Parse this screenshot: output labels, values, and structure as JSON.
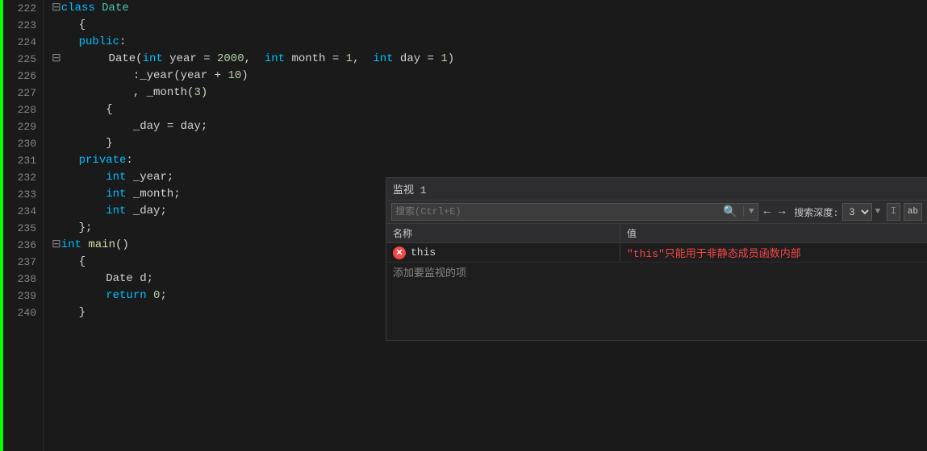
{
  "editor": {
    "lines": [
      {
        "num": "222",
        "content": [
          {
            "t": "⊟",
            "cls": "collapse"
          },
          {
            "t": "class ",
            "cls": "cyan"
          },
          {
            "t": "Date",
            "cls": "green"
          }
        ]
      },
      {
        "num": "223",
        "content": [
          {
            "t": "    {",
            "cls": "normal"
          }
        ]
      },
      {
        "num": "224",
        "content": [
          {
            "t": "    ",
            "cls": "normal"
          },
          {
            "t": "public",
            "cls": "cyan"
          },
          {
            "t": ":",
            "cls": "normal"
          }
        ]
      },
      {
        "num": "225",
        "content": [
          {
            "t": "⊟   ",
            "cls": "collapse"
          },
          {
            "t": "    Date(",
            "cls": "normal"
          },
          {
            "t": "int",
            "cls": "cyan"
          },
          {
            "t": " year = ",
            "cls": "normal"
          },
          {
            "t": "2000",
            "cls": "num"
          },
          {
            "t": ",  ",
            "cls": "normal"
          },
          {
            "t": "int",
            "cls": "cyan"
          },
          {
            "t": " month = ",
            "cls": "normal"
          },
          {
            "t": "1",
            "cls": "num"
          },
          {
            "t": ",  ",
            "cls": "normal"
          },
          {
            "t": "int",
            "cls": "cyan"
          },
          {
            "t": " day = ",
            "cls": "normal"
          },
          {
            "t": "1",
            "cls": "num"
          },
          {
            "t": ")",
            "cls": "normal"
          }
        ]
      },
      {
        "num": "226",
        "content": [
          {
            "t": "    ",
            "cls": "normal"
          },
          {
            "t": "    ",
            "cls": "normal"
          },
          {
            "t": "    :_year(year + ",
            "cls": "normal"
          },
          {
            "t": "10",
            "cls": "num"
          },
          {
            "t": ")",
            "cls": "normal"
          }
        ]
      },
      {
        "num": "227",
        "content": [
          {
            "t": "    ",
            "cls": "normal"
          },
          {
            "t": "    ",
            "cls": "normal"
          },
          {
            "t": "    , _month(",
            "cls": "normal"
          },
          {
            "t": "3",
            "cls": "num"
          },
          {
            "t": ")",
            "cls": "normal"
          }
        ]
      },
      {
        "num": "228",
        "content": [
          {
            "t": "    ",
            "cls": "normal"
          },
          {
            "t": "    {",
            "cls": "normal"
          }
        ]
      },
      {
        "num": "229",
        "content": [
          {
            "t": "    ",
            "cls": "normal"
          },
          {
            "t": "        _day = day;",
            "cls": "normal"
          }
        ]
      },
      {
        "num": "230",
        "content": [
          {
            "t": "    ",
            "cls": "normal"
          },
          {
            "t": "    }",
            "cls": "normal"
          }
        ]
      },
      {
        "num": "231",
        "content": [
          {
            "t": "    ",
            "cls": "normal"
          },
          {
            "t": "private",
            "cls": "cyan"
          },
          {
            "t": ":",
            "cls": "normal"
          }
        ]
      },
      {
        "num": "232",
        "content": [
          {
            "t": "    ",
            "cls": "normal"
          },
          {
            "t": "    ",
            "cls": "normal"
          },
          {
            "t": "int",
            "cls": "cyan"
          },
          {
            "t": " _year;",
            "cls": "normal"
          }
        ]
      },
      {
        "num": "233",
        "content": [
          {
            "t": "    ",
            "cls": "normal"
          },
          {
            "t": "    ",
            "cls": "normal"
          },
          {
            "t": "int",
            "cls": "cyan"
          },
          {
            "t": " _month;",
            "cls": "normal"
          }
        ]
      },
      {
        "num": "234",
        "content": [
          {
            "t": "    ",
            "cls": "normal"
          },
          {
            "t": "    ",
            "cls": "normal"
          },
          {
            "t": "int",
            "cls": "cyan"
          },
          {
            "t": " _day;",
            "cls": "normal"
          }
        ]
      },
      {
        "num": "235",
        "content": [
          {
            "t": "    }",
            "cls": "normal"
          },
          {
            "t": ";",
            "cls": "normal"
          }
        ]
      },
      {
        "num": "236",
        "content": [
          {
            "t": "⊟",
            "cls": "collapse"
          },
          {
            "t": "int",
            "cls": "cyan"
          },
          {
            "t": " ",
            "cls": "normal"
          },
          {
            "t": "main",
            "cls": "yellow"
          },
          {
            "t": "()",
            "cls": "normal"
          }
        ]
      },
      {
        "num": "237",
        "content": [
          {
            "t": "    {",
            "cls": "normal"
          }
        ]
      },
      {
        "num": "238",
        "content": [
          {
            "t": "    ",
            "cls": "normal"
          },
          {
            "t": "    Date d;",
            "cls": "normal"
          }
        ]
      },
      {
        "num": "239",
        "content": [
          {
            "t": "    ",
            "cls": "normal"
          },
          {
            "t": "    return ",
            "cls": "cyan"
          },
          {
            "t": "0",
            "cls": "num"
          },
          {
            "t": ";",
            "cls": "normal"
          }
        ]
      },
      {
        "num": "240",
        "content": [
          {
            "t": "    }",
            "cls": "normal"
          }
        ]
      }
    ]
  },
  "watch_panel": {
    "title": "监视 1",
    "search_placeholder": "搜索(Ctrl+E)",
    "search_icon": "🔍",
    "nav_back": "←",
    "nav_forward": "→",
    "depth_label": "搜索深度:",
    "depth_value": "3",
    "pin_icon": "📌",
    "ab_icon": "ab",
    "col_name": "名称",
    "col_value": "值",
    "rows": [
      {
        "name": "this",
        "value": "\"this\"只能用于非静态成员函数内部",
        "has_error": true
      }
    ],
    "add_watch_label": "添加要监视的项"
  }
}
